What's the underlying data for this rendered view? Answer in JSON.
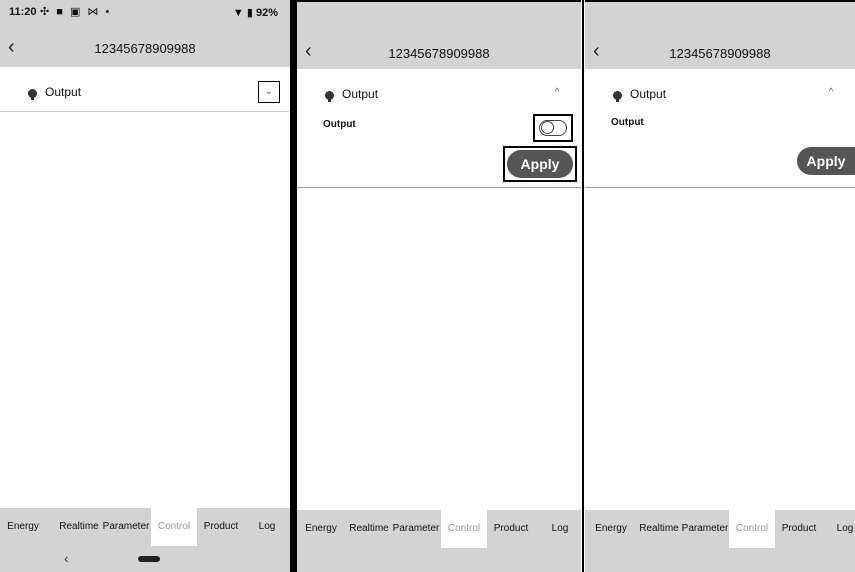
{
  "device_title": "12345678909988",
  "status_bar": {
    "time": "11:20",
    "icons": "✣ ■ ▣ ⋈ •",
    "battery": "▼ ▮ 92%"
  },
  "back_icon": "‹",
  "section": {
    "label": "Output",
    "chevron_collapsed": "⌄",
    "chevron_expanded": "^"
  },
  "control": {
    "sub_label": "Output",
    "apply_label": "Apply"
  },
  "tabs": [
    "Energy",
    "Realtime",
    "Parameter",
    "Control",
    "Product",
    "Log"
  ],
  "active_tab": "Control",
  "nav": {
    "back": "‹"
  }
}
